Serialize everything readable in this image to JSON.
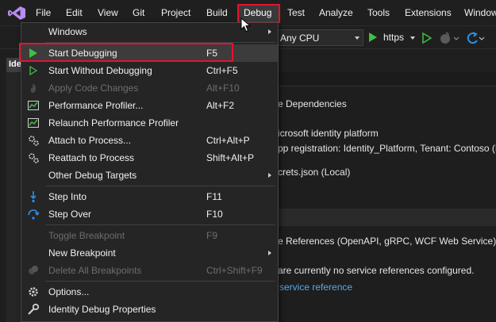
{
  "menubar": {
    "items": [
      "File",
      "Edit",
      "View",
      "Git",
      "Project",
      "Build",
      "Debug",
      "Test",
      "Analyze",
      "Tools",
      "Extensions",
      "Window"
    ],
    "active": "Debug"
  },
  "toolbar": {
    "platform": "Any CPU",
    "run_profile": "https"
  },
  "doc_tab": {
    "label": "Ide"
  },
  "content": {
    "dependencies_title": "e Dependencies",
    "identity_platform": "icrosoft identity platform",
    "app_registration": "pp registration: Identity_Platform, Tenant: Contoso (N",
    "secrets": "crets.json (Local)",
    "service_refs_title": "e References (OpenAPI, gRPC, WCF Web Service)",
    "no_refs": "are currently no service references configured.",
    "add_link": "service reference"
  },
  "debug_menu": {
    "items": [
      {
        "label": "Windows",
        "shortcut": "",
        "icon": "none",
        "submenu": true,
        "disabled": false
      },
      {
        "label": "Start Debugging",
        "shortcut": "F5",
        "icon": "play-solid-icon",
        "submenu": false,
        "disabled": false,
        "highlighted": true
      },
      {
        "label": "Start Without Debugging",
        "shortcut": "Ctrl+F5",
        "icon": "play-outline-icon",
        "submenu": false,
        "disabled": false
      },
      {
        "label": "Apply Code Changes",
        "shortcut": "Alt+F10",
        "icon": "flame-icon",
        "submenu": false,
        "disabled": true
      },
      {
        "label": "Performance Profiler...",
        "shortcut": "Alt+F2",
        "icon": "performance-chart-icon",
        "submenu": false,
        "disabled": false
      },
      {
        "label": "Relaunch Performance Profiler",
        "shortcut": "",
        "icon": "performance-chart-icon",
        "submenu": false,
        "disabled": false
      },
      {
        "label": "Attach to Process...",
        "shortcut": "Ctrl+Alt+P",
        "icon": "gears-icon",
        "submenu": false,
        "disabled": false
      },
      {
        "label": "Reattach to Process",
        "shortcut": "Shift+Alt+P",
        "icon": "gears-icon",
        "submenu": false,
        "disabled": false
      },
      {
        "label": "Other Debug Targets",
        "shortcut": "",
        "icon": "none",
        "submenu": true,
        "disabled": false
      },
      {
        "label": "Step Into",
        "shortcut": "F11",
        "icon": "step-into-icon",
        "submenu": false,
        "disabled": false
      },
      {
        "label": "Step Over",
        "shortcut": "F10",
        "icon": "step-over-icon",
        "submenu": false,
        "disabled": false
      },
      {
        "label": "Toggle Breakpoint",
        "shortcut": "F9",
        "icon": "none",
        "submenu": false,
        "disabled": true
      },
      {
        "label": "New Breakpoint",
        "shortcut": "",
        "icon": "none",
        "submenu": true,
        "disabled": false
      },
      {
        "label": "Delete All Breakpoints",
        "shortcut": "Ctrl+Shift+F9",
        "icon": "breakpoints-icon",
        "submenu": false,
        "disabled": true
      },
      {
        "label": "Options...",
        "shortcut": "",
        "icon": "gear-icon",
        "submenu": false,
        "disabled": false
      },
      {
        "label": "Identity Debug Properties",
        "shortcut": "",
        "icon": "wrench-icon",
        "submenu": false,
        "disabled": false
      }
    ]
  },
  "colors": {
    "accent_red": "#e8112d",
    "run_green": "#3fbf46",
    "link_blue": "#59a8e8",
    "step_blue": "#2f8fe0"
  }
}
